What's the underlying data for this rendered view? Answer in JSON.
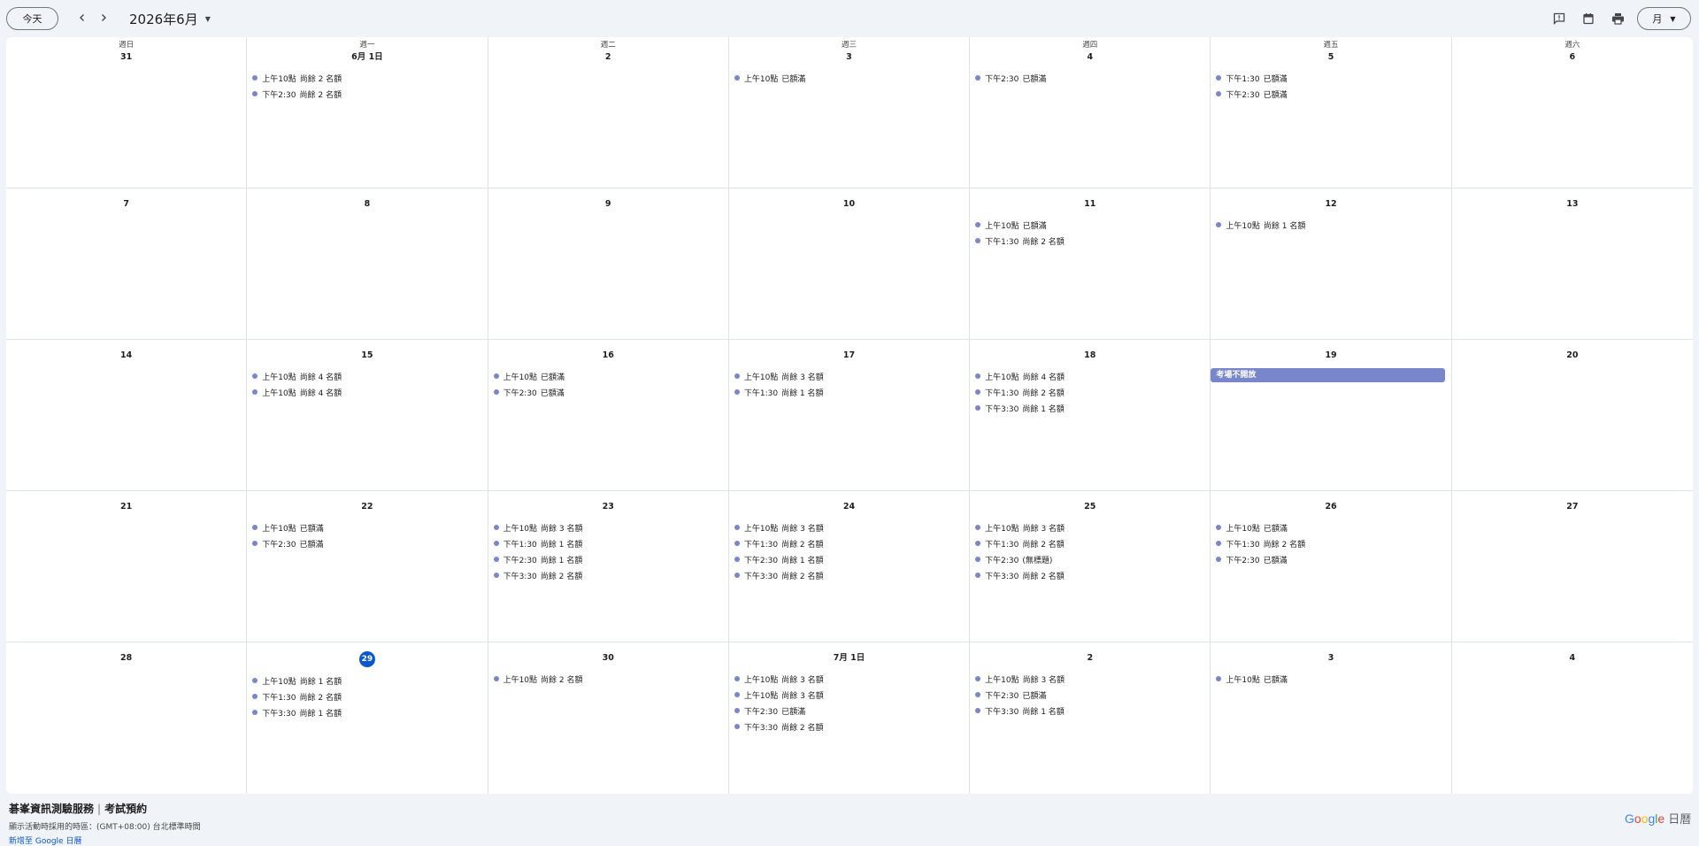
{
  "toolbar": {
    "today_label": "今天",
    "month_title": "2026年6月",
    "view_label": "月"
  },
  "weekdays": [
    "週日",
    "週一",
    "週二",
    "週三",
    "週四",
    "週五",
    "週六"
  ],
  "weeks": [
    [
      {
        "date": "31",
        "events": []
      },
      {
        "date": "6月 1日",
        "events": [
          {
            "time": "上午10點",
            "title": "尚餘 2 名額"
          },
          {
            "time": "下午2:30",
            "title": "尚餘 2 名額"
          }
        ]
      },
      {
        "date": "2",
        "events": []
      },
      {
        "date": "3",
        "events": [
          {
            "time": "上午10點",
            "title": "已額滿"
          }
        ]
      },
      {
        "date": "4",
        "events": [
          {
            "time": "下午2:30",
            "title": "已額滿"
          }
        ]
      },
      {
        "date": "5",
        "events": [
          {
            "time": "下午1:30",
            "title": "已額滿"
          },
          {
            "time": "下午2:30",
            "title": "已額滿"
          }
        ]
      },
      {
        "date": "6",
        "events": []
      }
    ],
    [
      {
        "date": "7",
        "events": []
      },
      {
        "date": "8",
        "events": []
      },
      {
        "date": "9",
        "events": []
      },
      {
        "date": "10",
        "events": []
      },
      {
        "date": "11",
        "events": [
          {
            "time": "上午10點",
            "title": "已額滿"
          },
          {
            "time": "下午1:30",
            "title": "尚餘 2 名額"
          }
        ]
      },
      {
        "date": "12",
        "events": [
          {
            "time": "上午10點",
            "title": "尚餘 1 名額"
          }
        ]
      },
      {
        "date": "13",
        "events": []
      }
    ],
    [
      {
        "date": "14",
        "events": []
      },
      {
        "date": "15",
        "events": [
          {
            "time": "上午10點",
            "title": "尚餘 4 名額"
          },
          {
            "time": "上午10點",
            "title": "尚餘 4 名額"
          }
        ]
      },
      {
        "date": "16",
        "events": [
          {
            "time": "上午10點",
            "title": "已額滿"
          },
          {
            "time": "下午2:30",
            "title": "已額滿"
          }
        ]
      },
      {
        "date": "17",
        "events": [
          {
            "time": "上午10點",
            "title": "尚餘 3 名額"
          },
          {
            "time": "下午1:30",
            "title": "尚餘 1 名額"
          }
        ]
      },
      {
        "date": "18",
        "events": [
          {
            "time": "上午10點",
            "title": "尚餘 4 名額"
          },
          {
            "time": "下午1:30",
            "title": "尚餘 2 名額"
          },
          {
            "time": "下午3:30",
            "title": "尚餘 1 名額"
          }
        ]
      },
      {
        "date": "19",
        "allday": "考場不開放",
        "events": []
      },
      {
        "date": "20",
        "events": []
      }
    ],
    [
      {
        "date": "21",
        "events": []
      },
      {
        "date": "22",
        "events": [
          {
            "time": "上午10點",
            "title": "已額滿"
          },
          {
            "time": "下午2:30",
            "title": "已額滿"
          }
        ]
      },
      {
        "date": "23",
        "events": [
          {
            "time": "上午10點",
            "title": "尚餘 3 名額"
          },
          {
            "time": "下午1:30",
            "title": "尚餘 1 名額"
          },
          {
            "time": "下午2:30",
            "title": "尚餘 1 名額"
          },
          {
            "time": "下午3:30",
            "title": "尚餘 2 名額"
          }
        ]
      },
      {
        "date": "24",
        "events": [
          {
            "time": "上午10點",
            "title": "尚餘 3 名額"
          },
          {
            "time": "下午1:30",
            "title": "尚餘 2 名額"
          },
          {
            "time": "下午2:30",
            "title": "尚餘 1 名額"
          },
          {
            "time": "下午3:30",
            "title": "尚餘 2 名額"
          }
        ]
      },
      {
        "date": "25",
        "events": [
          {
            "time": "上午10點",
            "title": "尚餘 3 名額"
          },
          {
            "time": "下午1:30",
            "title": "尚餘 2 名額"
          },
          {
            "time": "下午2:30",
            "title": "(無標題)"
          },
          {
            "time": "下午3:30",
            "title": "尚餘 2 名額"
          }
        ]
      },
      {
        "date": "26",
        "events": [
          {
            "time": "上午10點",
            "title": "已額滿"
          },
          {
            "time": "下午1:30",
            "title": "尚餘 2 名額"
          },
          {
            "time": "下午2:30",
            "title": "已額滿"
          }
        ]
      },
      {
        "date": "27",
        "events": []
      }
    ],
    [
      {
        "date": "28",
        "events": []
      },
      {
        "date": "29",
        "today": true,
        "events": [
          {
            "time": "上午10點",
            "title": "尚餘 1 名額"
          },
          {
            "time": "下午1:30",
            "title": "尚餘 2 名額"
          },
          {
            "time": "下午3:30",
            "title": "尚餘 1 名額"
          }
        ]
      },
      {
        "date": "30",
        "events": [
          {
            "time": "上午10點",
            "title": "尚餘 2 名額"
          }
        ]
      },
      {
        "date": "7月 1日",
        "events": [
          {
            "time": "上午10點",
            "title": "尚餘 3 名額"
          },
          {
            "time": "上午10點",
            "title": "尚餘 3 名額"
          },
          {
            "time": "下午2:30",
            "title": "已額滿"
          },
          {
            "time": "下午3:30",
            "title": "尚餘 2 名額"
          }
        ]
      },
      {
        "date": "2",
        "events": [
          {
            "time": "上午10點",
            "title": "尚餘 3 名額"
          },
          {
            "time": "下午2:30",
            "title": "已額滿"
          },
          {
            "time": "下午3:30",
            "title": "尚餘 1 名額"
          }
        ]
      },
      {
        "date": "3",
        "events": [
          {
            "time": "上午10點",
            "title": "已額滿"
          }
        ]
      },
      {
        "date": "4",
        "events": []
      }
    ]
  ],
  "footer": {
    "title": "碁峯資訊測驗服務",
    "subtitle": "考試預約",
    "timezone": "顯示活動時採用的時區：(GMT+08:00) 台北標準時間",
    "add_link": "新增至 Google 日曆",
    "logo_suffix": "日曆"
  },
  "colors": {
    "event_dot": "#7986cb",
    "allday_bg": "#7986cb",
    "today_circle": "#0b57d0",
    "page_bg": "#f0f4f9"
  }
}
